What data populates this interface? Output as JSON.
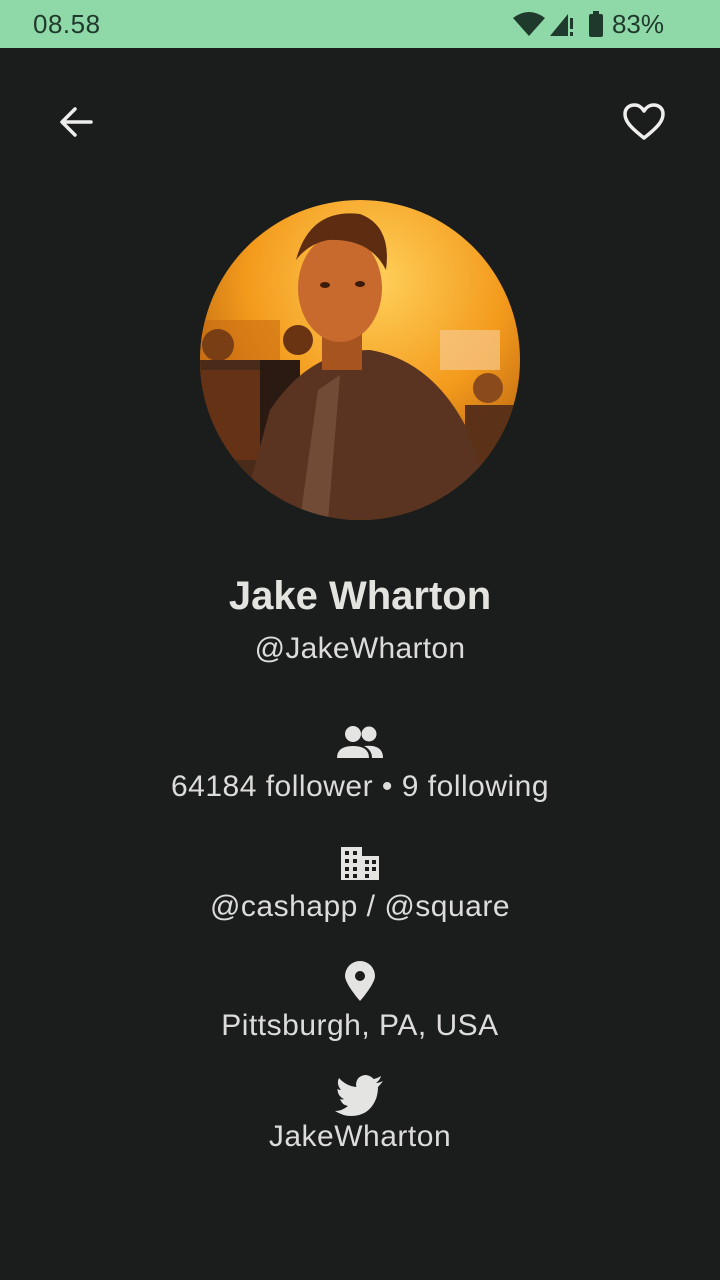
{
  "status_bar": {
    "time": "08.58",
    "battery": "83%",
    "icons": [
      "wifi-icon",
      "signal-icon",
      "battery-icon"
    ]
  },
  "toolbar": {
    "back_icon": "arrow-back-icon",
    "favorite_icon": "heart-outline-icon"
  },
  "profile": {
    "name": "Jake Wharton",
    "username": "@JakeWharton",
    "followers_text": "64184 follower • 9 following",
    "company": "@cashapp / @square",
    "location": "Pittsburgh, PA, USA",
    "twitter": "JakeWharton"
  },
  "colors": {
    "background": "#1b1c1c",
    "status_bar": "#8fd8a8",
    "text": "#e4e4e2"
  }
}
